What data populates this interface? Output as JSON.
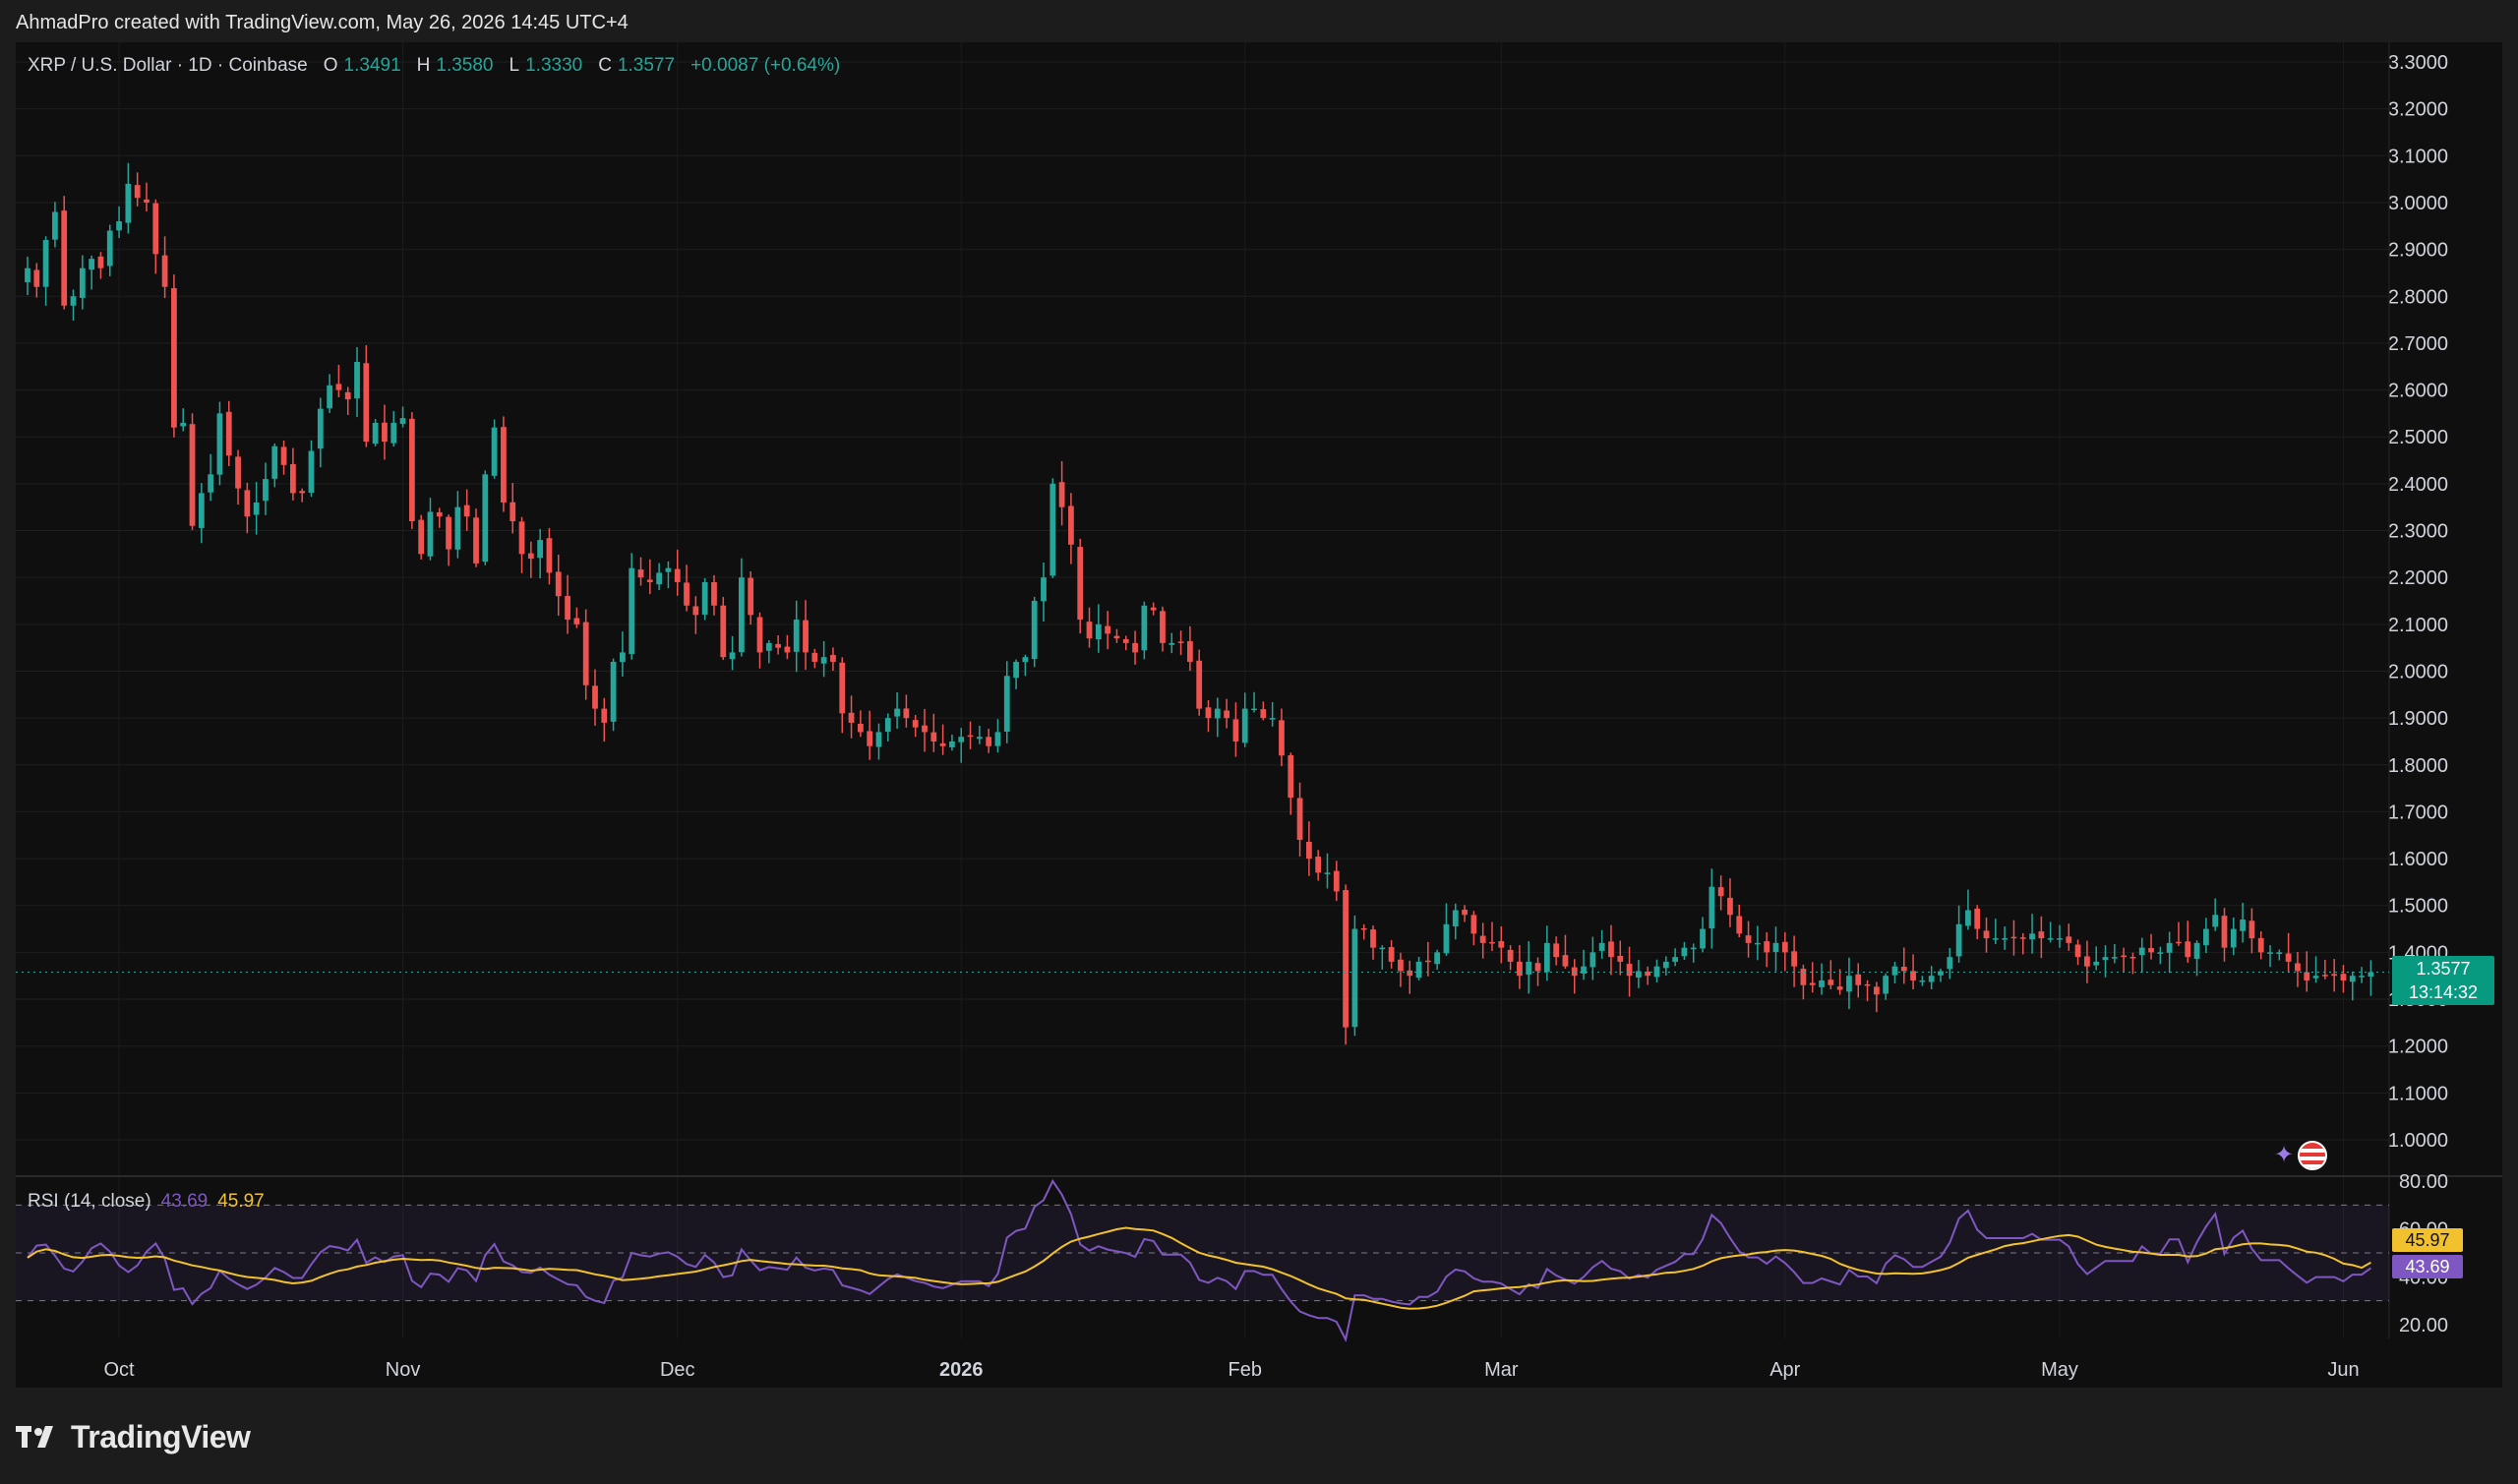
{
  "header": {
    "attribution": "AhmadPro created with TradingView.com, May 26, 2026 14:45 UTC+4"
  },
  "legend": {
    "symbol": "XRP / U.S. Dollar · 1D · Coinbase",
    "open_label": "O",
    "open": "1.3491",
    "high_label": "H",
    "high": "1.3580",
    "low_label": "L",
    "low": "1.3330",
    "close_label": "C",
    "close": "1.3577",
    "change": "+0.0087 (+0.64%)"
  },
  "rsi_legend": {
    "name": "RSI (14, close)",
    "rsi": "43.69",
    "ma": "45.97"
  },
  "price_tag": {
    "price": "1.3577",
    "countdown": "13:14:32"
  },
  "rsi_tags": {
    "ma": "45.97",
    "rsi": "43.69"
  },
  "footer": {
    "brand": "TradingView"
  },
  "icons": {
    "brand": "tradingview-logo-icon",
    "flag": "us-flag-icon",
    "spark": "sparkle-icon"
  },
  "colors": {
    "up": "#26a69a",
    "down": "#ef5350",
    "rsi_line": "#7e57c2",
    "rsi_ma": "#f2c22e",
    "bg": "#0f0f0f",
    "frame": "#1c1c1c"
  },
  "chart_data": [
    {
      "type": "candlestick",
      "title": "XRP / U.S. Dollar · 1D · Coinbase",
      "ylim": [
        0.92,
        3.33
      ],
      "y_ticks": [
        "3.3000",
        "3.2000",
        "3.1000",
        "3.0000",
        "2.9000",
        "2.8000",
        "2.7000",
        "2.6000",
        "2.5000",
        "2.4000",
        "2.3000",
        "2.2000",
        "2.1000",
        "2.0000",
        "1.9000",
        "1.8000",
        "1.7000",
        "1.6000",
        "1.5000",
        "1.4000",
        "1.3000",
        "1.2000",
        "1.1000",
        "1.0000"
      ],
      "x_ticks": [
        "Oct",
        "Nov",
        "Dec",
        "2026",
        "Feb",
        "Mar",
        "Apr",
        "May",
        "Jun"
      ],
      "x_tick_index": [
        10,
        41,
        71,
        102,
        133,
        161,
        192,
        222,
        253
      ],
      "first_bar_date": "2025-09-30",
      "last_price": 1.3577,
      "grid": true,
      "close": [
        2.86,
        2.82,
        2.92,
        2.98,
        2.78,
        2.8,
        2.86,
        2.88,
        2.86,
        2.94,
        2.96,
        3.04,
        3.01,
        3.0,
        2.89,
        2.82,
        2.52,
        2.53,
        2.31,
        2.38,
        2.42,
        2.55,
        2.46,
        2.39,
        2.33,
        2.36,
        2.41,
        2.48,
        2.44,
        2.38,
        2.38,
        2.47,
        2.56,
        2.61,
        2.6,
        2.58,
        2.66,
        2.49,
        2.53,
        2.49,
        2.53,
        2.54,
        2.32,
        2.25,
        2.34,
        2.33,
        2.26,
        2.35,
        2.33,
        2.23,
        2.42,
        2.52,
        2.36,
        2.32,
        2.25,
        2.24,
        2.28,
        2.21,
        2.16,
        2.11,
        2.1,
        1.97,
        1.92,
        1.89,
        2.02,
        2.04,
        2.22,
        2.2,
        2.19,
        2.21,
        2.22,
        2.19,
        2.14,
        2.12,
        2.19,
        2.14,
        2.03,
        2.04,
        2.2,
        2.12,
        2.04,
        2.06,
        2.05,
        2.04,
        2.11,
        2.04,
        2.02,
        2.03,
        2.02,
        1.91,
        1.89,
        1.87,
        1.84,
        1.87,
        1.9,
        1.92,
        1.9,
        1.88,
        1.87,
        1.85,
        1.84,
        1.85,
        1.86,
        1.86,
        1.86,
        1.84,
        1.87,
        1.99,
        2.02,
        2.03,
        2.15,
        2.2,
        2.4,
        2.35,
        2.27,
        2.11,
        2.07,
        2.1,
        2.08,
        2.07,
        2.06,
        2.04,
        2.14,
        2.13,
        2.06,
        2.06,
        2.06,
        2.02,
        1.92,
        1.9,
        1.92,
        1.9,
        1.85,
        1.92,
        1.92,
        1.9,
        1.9,
        1.82,
        1.73,
        1.64,
        1.6,
        1.57,
        1.57,
        1.53,
        1.24,
        1.45,
        1.45,
        1.41,
        1.41,
        1.38,
        1.36,
        1.35,
        1.38,
        1.38,
        1.4,
        1.46,
        1.49,
        1.48,
        1.44,
        1.42,
        1.42,
        1.41,
        1.38,
        1.35,
        1.38,
        1.36,
        1.42,
        1.39,
        1.37,
        1.35,
        1.37,
        1.4,
        1.42,
        1.39,
        1.38,
        1.35,
        1.36,
        1.35,
        1.37,
        1.38,
        1.39,
        1.41,
        1.41,
        1.45,
        1.54,
        1.52,
        1.48,
        1.44,
        1.42,
        1.42,
        1.4,
        1.42,
        1.4,
        1.37,
        1.33,
        1.33,
        1.34,
        1.33,
        1.32,
        1.35,
        1.33,
        1.33,
        1.31,
        1.35,
        1.37,
        1.36,
        1.34,
        1.34,
        1.35,
        1.36,
        1.39,
        1.46,
        1.49,
        1.45,
        1.43,
        1.43,
        1.43,
        1.43,
        1.43,
        1.44,
        1.43,
        1.43,
        1.43,
        1.42,
        1.39,
        1.37,
        1.38,
        1.39,
        1.39,
        1.39,
        1.39,
        1.41,
        1.4,
        1.4,
        1.42,
        1.42,
        1.39,
        1.42,
        1.45,
        1.48,
        1.41,
        1.45,
        1.47,
        1.43,
        1.4,
        1.4,
        1.4,
        1.38,
        1.36,
        1.34,
        1.35,
        1.35,
        1.35,
        1.34,
        1.35,
        1.35,
        1.3577
      ]
    },
    {
      "type": "line",
      "title": "RSI (14, close)",
      "ylim": [
        16,
        81
      ],
      "y_ticks": [
        "80.00",
        "60.00",
        "40.00",
        "20.00"
      ],
      "bands": [
        30,
        50,
        70
      ],
      "series": [
        {
          "name": "RSI",
          "color": "#7e57c2",
          "last": 43.69
        },
        {
          "name": "MA",
          "color": "#f2c22e",
          "last": 45.97
        }
      ]
    }
  ]
}
